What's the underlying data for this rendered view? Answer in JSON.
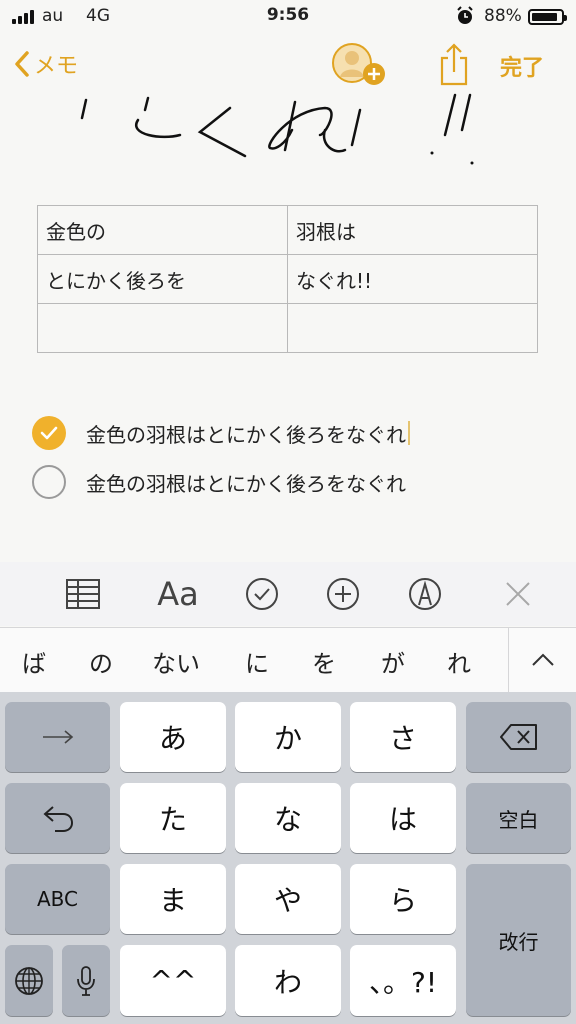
{
  "status": {
    "carrier": "au",
    "network": "4G",
    "time": "9:56",
    "battery": "88%",
    "battery_level": 0.88
  },
  "nav": {
    "back_label": "メモ",
    "done_label": "完了"
  },
  "table": [
    [
      "金色の",
      "羽根は"
    ],
    [
      "とにかく後ろを",
      "なぐれ!!"
    ],
    [
      "",
      ""
    ]
  ],
  "checklist": [
    {
      "text": "金色の羽根はとにかく後ろをなぐれ",
      "checked": true
    },
    {
      "text": "金色の羽根はとにかく後ろをなぐれ",
      "checked": false
    }
  ],
  "toolbar": {
    "format_label": "Aa",
    "icons": [
      "table-icon",
      "format-icon",
      "checklist-icon",
      "add-icon",
      "markup-icon",
      "close-icon"
    ]
  },
  "candidates": [
    "ば",
    "の",
    "ない",
    "に",
    "を",
    "が",
    "れ"
  ],
  "keyboard": {
    "row1": [
      "あ",
      "か",
      "さ"
    ],
    "row2": [
      "た",
      "な",
      "は"
    ],
    "row3": [
      "ま",
      "や",
      "ら"
    ],
    "row4": [
      "^^",
      "わ",
      "、。?!"
    ],
    "abc": "ABC",
    "space": "空白",
    "return": "改行"
  },
  "colors": {
    "accent": "#e0a321",
    "check": "#f0b12c"
  }
}
